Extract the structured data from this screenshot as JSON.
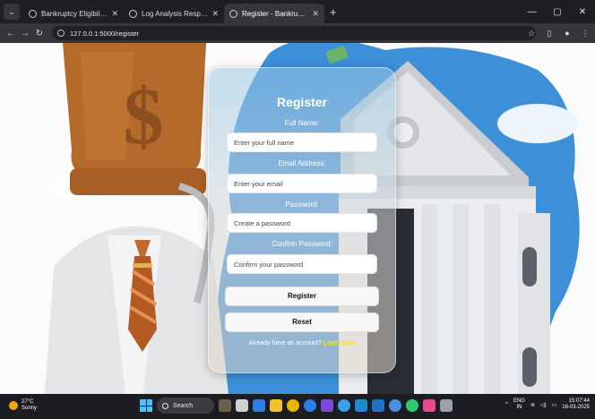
{
  "browser": {
    "tabs": [
      {
        "title": "Bankruptcy Eligibility Check",
        "active": false
      },
      {
        "title": "Log Analysis Response",
        "active": false
      },
      {
        "title": "Register - Bankruptcy Portal",
        "active": true
      }
    ],
    "url": "127.0.0.1:5000/register",
    "icons": {
      "back": "arrow-left-icon",
      "forward": "arrow-right-icon",
      "reload": "reload-icon",
      "bookmark": "star-icon",
      "menu": "more-vertical-icon"
    }
  },
  "form": {
    "title": "Register",
    "full_name_label": "Full Name:",
    "full_name_placeholder": "Enter your full name",
    "email_label": "Email Address:",
    "email_placeholder": "Enter your email",
    "password_label": "Password:",
    "password_placeholder": "Create a password",
    "confirm_label": "Confirm Password:",
    "confirm_placeholder": "Confirm your password",
    "register_button": "Register",
    "reset_button": "Reset",
    "login_prompt": "Already have an account?",
    "login_link": "Login here"
  },
  "taskbar": {
    "temperature": "27°C",
    "condition": "Sunny",
    "search_label": "Search",
    "language": "ENG",
    "region": "IN",
    "time": "15:07:44",
    "date": "16-03-2025"
  },
  "colors": {
    "accent_yellow": "#ffe600",
    "bag_brown": "#b46a2b",
    "sky_blue": "#3d8fd8"
  }
}
